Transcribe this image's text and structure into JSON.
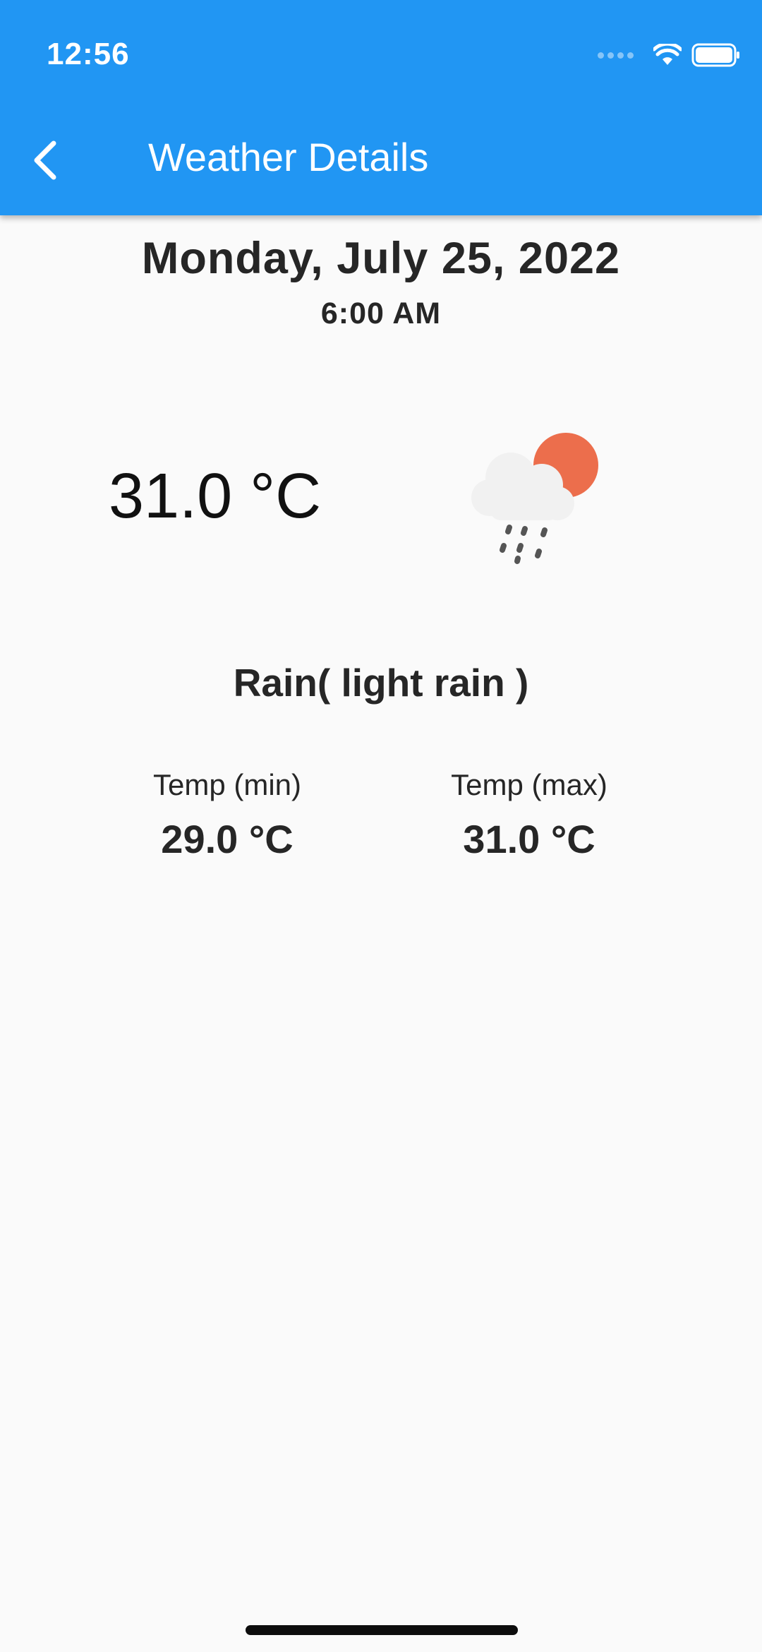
{
  "status_bar": {
    "time": "12:56",
    "icons": [
      "cellular-signal-icon",
      "wifi-icon",
      "battery-icon"
    ]
  },
  "app_bar": {
    "back_icon": "chevron-left-icon",
    "title": "Weather Details"
  },
  "weather": {
    "date": "Monday, July 25, 2022",
    "time": "6:00 AM",
    "current_temp": "31.0 °C",
    "icon": "rain-sun-cloud-icon",
    "condition": "Rain( light rain )",
    "temp_min": {
      "label": "Temp (min)",
      "value": "29.0 °C"
    },
    "temp_max": {
      "label": "Temp (max)",
      "value": "31.0 °C"
    }
  },
  "colors": {
    "app_bar": "#2196f3",
    "background": "#fafafa",
    "sun": "#ec6e4c",
    "cloud": "#f1f1f1",
    "rain": "#555555"
  }
}
